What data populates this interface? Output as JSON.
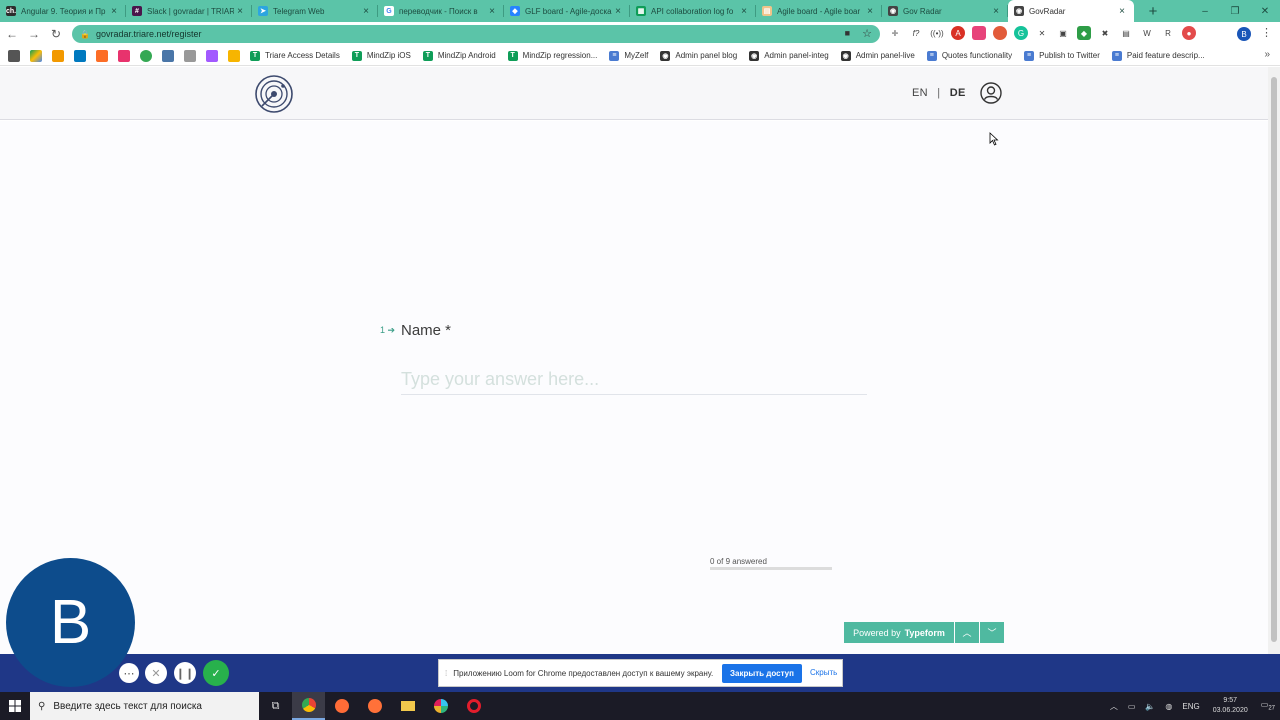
{
  "browser": {
    "tabs": [
      {
        "label": "Angular 9. Теория и Пр",
        "favicon": "ch-icon",
        "color": "#2d2d2d",
        "glyph": "ch."
      },
      {
        "label": "Slack | govradar | TRIAR",
        "favicon": "slack-icon",
        "color": "#4a154b",
        "glyph": "#"
      },
      {
        "label": "Telegram Web",
        "favicon": "telegram-icon",
        "color": "#2ca5e0",
        "glyph": "➤"
      },
      {
        "label": "переводчик - Поиск в",
        "favicon": "google-icon",
        "color": "#ffffff",
        "glyph": "G"
      },
      {
        "label": "GLF board - Agile-доска",
        "favicon": "jira-icon",
        "color": "#2684ff",
        "glyph": "◆"
      },
      {
        "label": "API collaboration log fo",
        "favicon": "sheets-icon",
        "color": "#0f9d58",
        "glyph": "▦"
      },
      {
        "label": "Agile board - Agile boar",
        "favicon": "page-icon",
        "color": "#f0c48a",
        "glyph": "▤"
      },
      {
        "label": "Gov Radar",
        "favicon": "globe-icon",
        "color": "#444444",
        "glyph": "◉"
      },
      {
        "label": "GovRadar",
        "favicon": "globe-icon",
        "color": "#444444",
        "glyph": "◉",
        "active": true
      }
    ],
    "new_tab": "+",
    "window_controls": [
      "–",
      "❐",
      "✕"
    ],
    "url": "govradar.triare.net/register",
    "bookmarks": [
      {
        "label": "Triare Access Details",
        "color": "#0f9d58",
        "glyph": "T"
      },
      {
        "label": "MindZip iOS",
        "color": "#0f9d58",
        "glyph": "T"
      },
      {
        "label": "MindZip Android",
        "color": "#0f9d58",
        "glyph": "T"
      },
      {
        "label": "MindZip regression...",
        "color": "#0f9d58",
        "glyph": "T"
      },
      {
        "label": "MyZelf",
        "color": "#4a7bd1",
        "glyph": "≡"
      },
      {
        "label": "Admin panel blog",
        "color": "#333333",
        "glyph": "◉"
      },
      {
        "label": "Admin panel-integ",
        "color": "#333333",
        "glyph": "◉"
      },
      {
        "label": "Admin panel-live",
        "color": "#333333",
        "glyph": "◉"
      },
      {
        "label": "Quotes functionality",
        "color": "#4a7bd1",
        "glyph": "≡"
      },
      {
        "label": "Publish to Twitter",
        "color": "#4a7bd1",
        "glyph": "≡"
      },
      {
        "label": "Paid feature descrip...",
        "color": "#4a7bd1",
        "glyph": "≡"
      }
    ],
    "profile_initial": "B"
  },
  "site": {
    "lang_en": "EN",
    "lang_sep": "|",
    "lang_de": "DE"
  },
  "form": {
    "question_number": "1",
    "question_arrow": "➔",
    "question_label": "Name *",
    "answer_placeholder": "Type your answer here...",
    "answer_value": "",
    "progress_text": "0 of 9 answered",
    "progress_fraction": 0,
    "powered_by": "Powered by",
    "brand": "Typeform"
  },
  "loom": {
    "avatar_initial": "B",
    "notice_text": "Приложению Loom for Chrome предоставлен доступ к вашему экрану.",
    "stop_label": "Закрыть доступ",
    "hide_label": "Скрыть"
  },
  "taskbar": {
    "search_placeholder": "Введите здесь текст для поиска",
    "language": "ENG",
    "time": "9:57",
    "date": "03.06.2020",
    "notification_count": "27"
  },
  "colors": {
    "accent": "#5bc4a8",
    "loom_blue": "#1f3787",
    "avatar": "#0d4c8c"
  }
}
